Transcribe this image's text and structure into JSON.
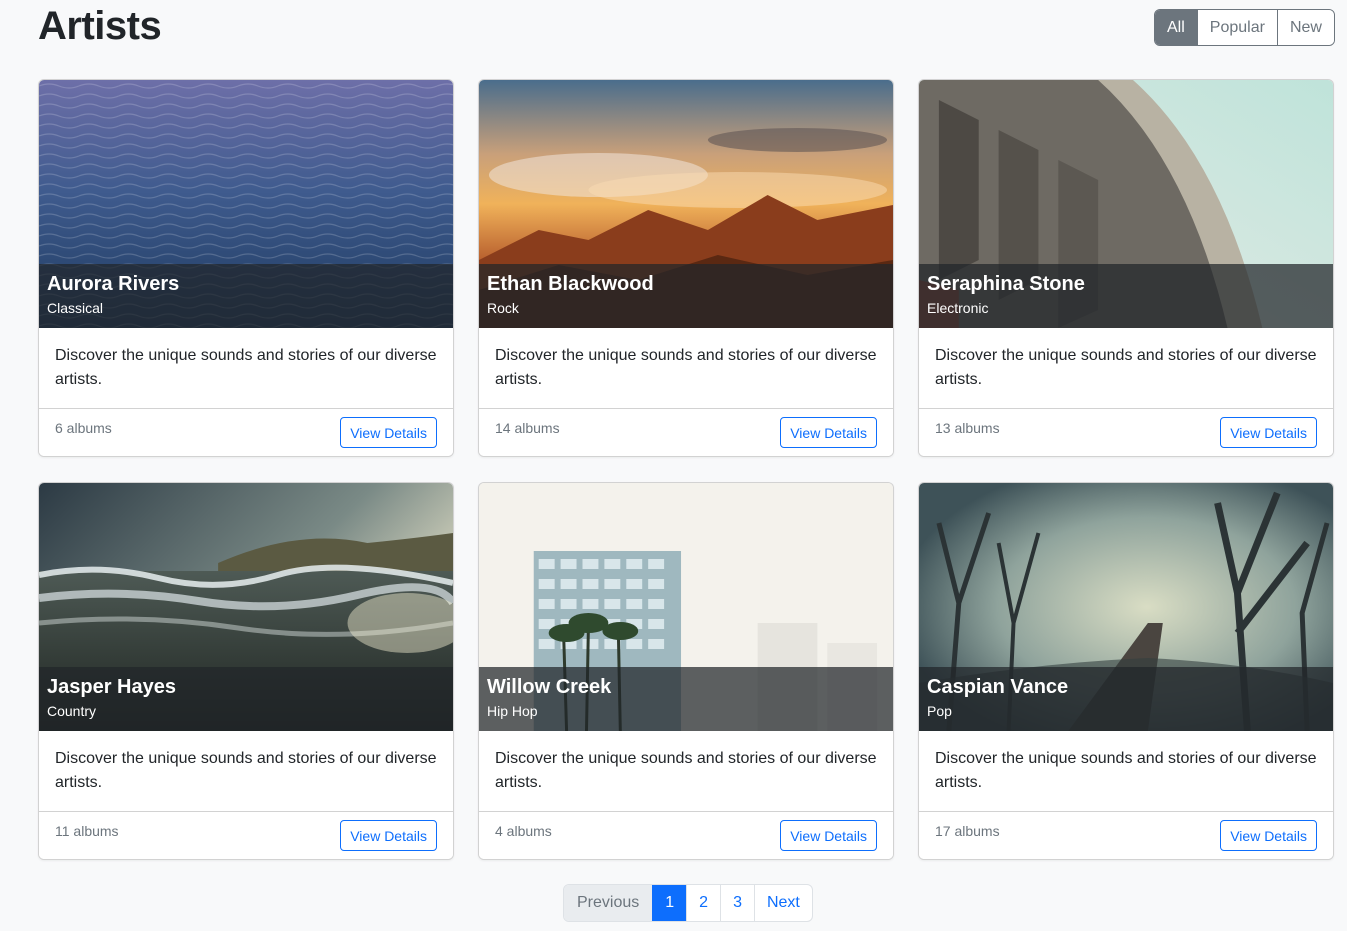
{
  "page": {
    "title": "Artists"
  },
  "filters": [
    {
      "label": "All",
      "active": true
    },
    {
      "label": "Popular",
      "active": false
    },
    {
      "label": "New",
      "active": false
    }
  ],
  "artists": [
    {
      "name": "Aurora Rivers",
      "genre": "Classical",
      "description": "Discover the unique sounds and stories of our diverse artists.",
      "albums": "6 albums",
      "button": "View Details",
      "image": "ocean-waves"
    },
    {
      "name": "Ethan Blackwood",
      "genre": "Rock",
      "description": "Discover the unique sounds and stories of our diverse artists.",
      "albums": "14 albums",
      "button": "View Details",
      "image": "mountain-sunset"
    },
    {
      "name": "Seraphina Stone",
      "genre": "Electronic",
      "description": "Discover the unique sounds and stories of our diverse artists.",
      "albums": "13 albums",
      "button": "View Details",
      "image": "concrete-bridge"
    },
    {
      "name": "Jasper Hayes",
      "genre": "Country",
      "description": "Discover the unique sounds and stories of our diverse artists.",
      "albums": "11 albums",
      "button": "View Details",
      "image": "stormy-beach"
    },
    {
      "name": "Willow Creek",
      "genre": "Hip Hop",
      "description": "Discover the unique sounds and stories of our diverse artists.",
      "albums": "4 albums",
      "button": "View Details",
      "image": "tower-palms"
    },
    {
      "name": "Caspian Vance",
      "genre": "Pop",
      "description": "Discover the unique sounds and stories of our diverse artists.",
      "albums": "17 albums",
      "button": "View Details",
      "image": "foggy-forest-railway"
    }
  ],
  "pagination": {
    "previous": "Previous",
    "pages": [
      "1",
      "2",
      "3"
    ],
    "current": "1",
    "next": "Next"
  },
  "colors": {
    "primary": "#0d6efd",
    "secondary": "#6c757d",
    "background": "#f8f9fa",
    "overlay": "#212529"
  }
}
